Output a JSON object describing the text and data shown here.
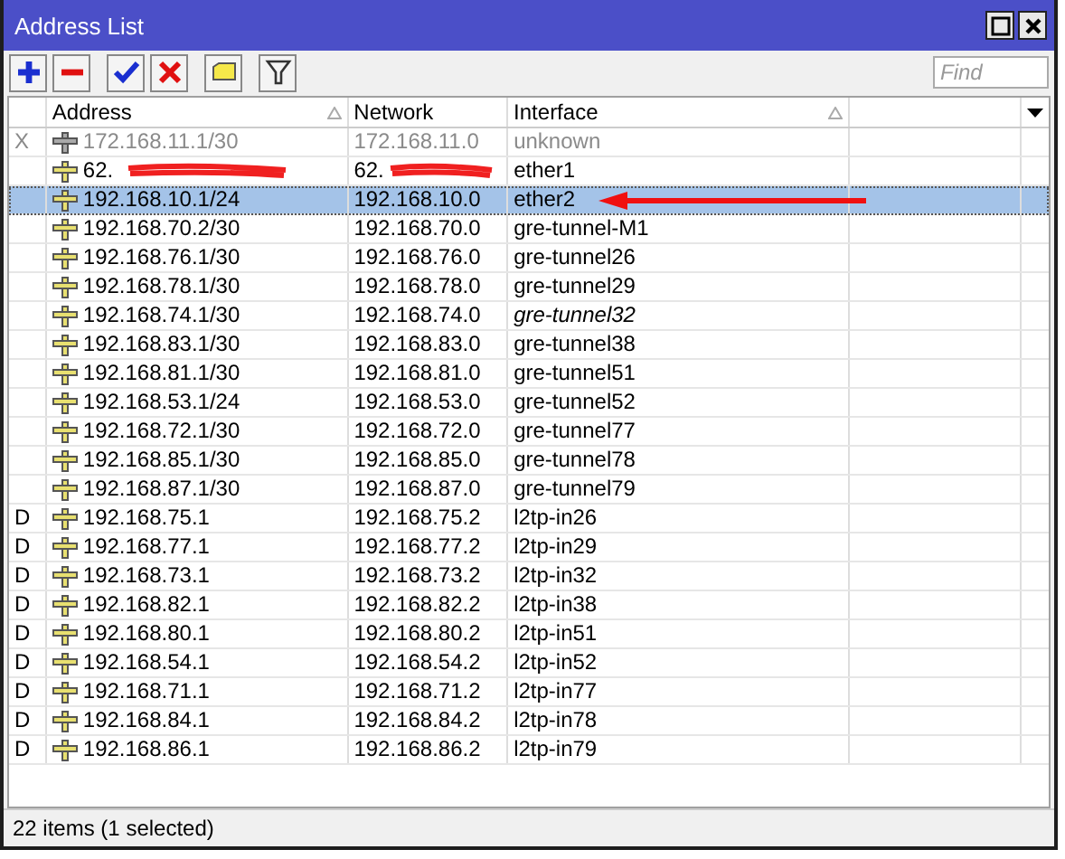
{
  "window": {
    "title": "Address List"
  },
  "toolbar": [
    {
      "kind": "add"
    },
    {
      "kind": "remove"
    },
    {
      "kind": "enable"
    },
    {
      "kind": "disable"
    },
    {
      "kind": "comment"
    },
    {
      "kind": "filter"
    }
  ],
  "search": {
    "placeholder": "Find"
  },
  "table": {
    "columns": [
      {},
      {
        "label": "Address",
        "sorted": true
      },
      {
        "label": "Network",
        "sorted": false
      },
      {
        "label": "Interface",
        "sorted": true
      },
      {}
    ],
    "rows": [
      {
        "flag": "X",
        "address": "172.168.11.1/30",
        "network": "172.168.11.0",
        "interface": "unknown",
        "disabled": true,
        "inactive": false,
        "selected": false,
        "redacted": false,
        "marked": false
      },
      {
        "address": "62.",
        "network": "62.",
        "interface": "ether1",
        "disabled": false,
        "inactive": false,
        "selected": false,
        "redacted": true,
        "marked": false
      },
      {
        "address": "192.168.10.1/24",
        "network": "192.168.10.0",
        "interface": "ether2",
        "disabled": false,
        "inactive": false,
        "selected": true,
        "redacted": false,
        "marked": true
      },
      {
        "address": "192.168.70.2/30",
        "network": "192.168.70.0",
        "interface": "gre-tunnel-M1",
        "disabled": false,
        "inactive": false,
        "selected": false,
        "redacted": false,
        "marked": false
      },
      {
        "address": "192.168.76.1/30",
        "network": "192.168.76.0",
        "interface": "gre-tunnel26",
        "disabled": false,
        "inactive": false,
        "selected": false,
        "redacted": false,
        "marked": false
      },
      {
        "address": "192.168.78.1/30",
        "network": "192.168.78.0",
        "interface": "gre-tunnel29",
        "disabled": false,
        "inactive": false,
        "selected": false,
        "redacted": false,
        "marked": false
      },
      {
        "address": "192.168.74.1/30",
        "network": "192.168.74.0",
        "interface": "gre-tunnel32",
        "disabled": false,
        "inactive": true,
        "selected": false,
        "redacted": false,
        "marked": false
      },
      {
        "address": "192.168.83.1/30",
        "network": "192.168.83.0",
        "interface": "gre-tunnel38",
        "disabled": false,
        "inactive": false,
        "selected": false,
        "redacted": false,
        "marked": false
      },
      {
        "address": "192.168.81.1/30",
        "network": "192.168.81.0",
        "interface": "gre-tunnel51",
        "disabled": false,
        "inactive": false,
        "selected": false,
        "redacted": false,
        "marked": false
      },
      {
        "address": "192.168.53.1/24",
        "network": "192.168.53.0",
        "interface": "gre-tunnel52",
        "disabled": false,
        "inactive": false,
        "selected": false,
        "redacted": false,
        "marked": false
      },
      {
        "address": "192.168.72.1/30",
        "network": "192.168.72.0",
        "interface": "gre-tunnel77",
        "disabled": false,
        "inactive": false,
        "selected": false,
        "redacted": false,
        "marked": false
      },
      {
        "address": "192.168.85.1/30",
        "network": "192.168.85.0",
        "interface": "gre-tunnel78",
        "disabled": false,
        "inactive": false,
        "selected": false,
        "redacted": false,
        "marked": false
      },
      {
        "address": "192.168.87.1/30",
        "network": "192.168.87.0",
        "interface": "gre-tunnel79",
        "disabled": false,
        "inactive": false,
        "selected": false,
        "redacted": false,
        "marked": false
      },
      {
        "flag": "D",
        "address": "192.168.75.1",
        "network": "192.168.75.2",
        "interface": "l2tp-in26",
        "disabled": false,
        "inactive": false,
        "selected": false,
        "redacted": false,
        "marked": false
      },
      {
        "flag": "D",
        "address": "192.168.77.1",
        "network": "192.168.77.2",
        "interface": "l2tp-in29",
        "disabled": false,
        "inactive": false,
        "selected": false,
        "redacted": false,
        "marked": false
      },
      {
        "flag": "D",
        "address": "192.168.73.1",
        "network": "192.168.73.2",
        "interface": "l2tp-in32",
        "disabled": false,
        "inactive": false,
        "selected": false,
        "redacted": false,
        "marked": false
      },
      {
        "flag": "D",
        "address": "192.168.82.1",
        "network": "192.168.82.2",
        "interface": "l2tp-in38",
        "disabled": false,
        "inactive": false,
        "selected": false,
        "redacted": false,
        "marked": false
      },
      {
        "flag": "D",
        "address": "192.168.80.1",
        "network": "192.168.80.2",
        "interface": "l2tp-in51",
        "disabled": false,
        "inactive": false,
        "selected": false,
        "redacted": false,
        "marked": false
      },
      {
        "flag": "D",
        "address": "192.168.54.1",
        "network": "192.168.54.2",
        "interface": "l2tp-in52",
        "disabled": false,
        "inactive": false,
        "selected": false,
        "redacted": false,
        "marked": false
      },
      {
        "flag": "D",
        "address": "192.168.71.1",
        "network": "192.168.71.2",
        "interface": "l2tp-in77",
        "disabled": false,
        "inactive": false,
        "selected": false,
        "redacted": false,
        "marked": false
      },
      {
        "flag": "D",
        "address": "192.168.84.1",
        "network": "192.168.84.2",
        "interface": "l2tp-in78",
        "disabled": false,
        "inactive": false,
        "selected": false,
        "redacted": false,
        "marked": false
      },
      {
        "flag": "D",
        "address": "192.168.86.1",
        "network": "192.168.86.2",
        "interface": "l2tp-in79",
        "disabled": false,
        "inactive": false,
        "selected": false,
        "redacted": false,
        "marked": false
      }
    ]
  },
  "status_bar": "22 items (1 selected)"
}
